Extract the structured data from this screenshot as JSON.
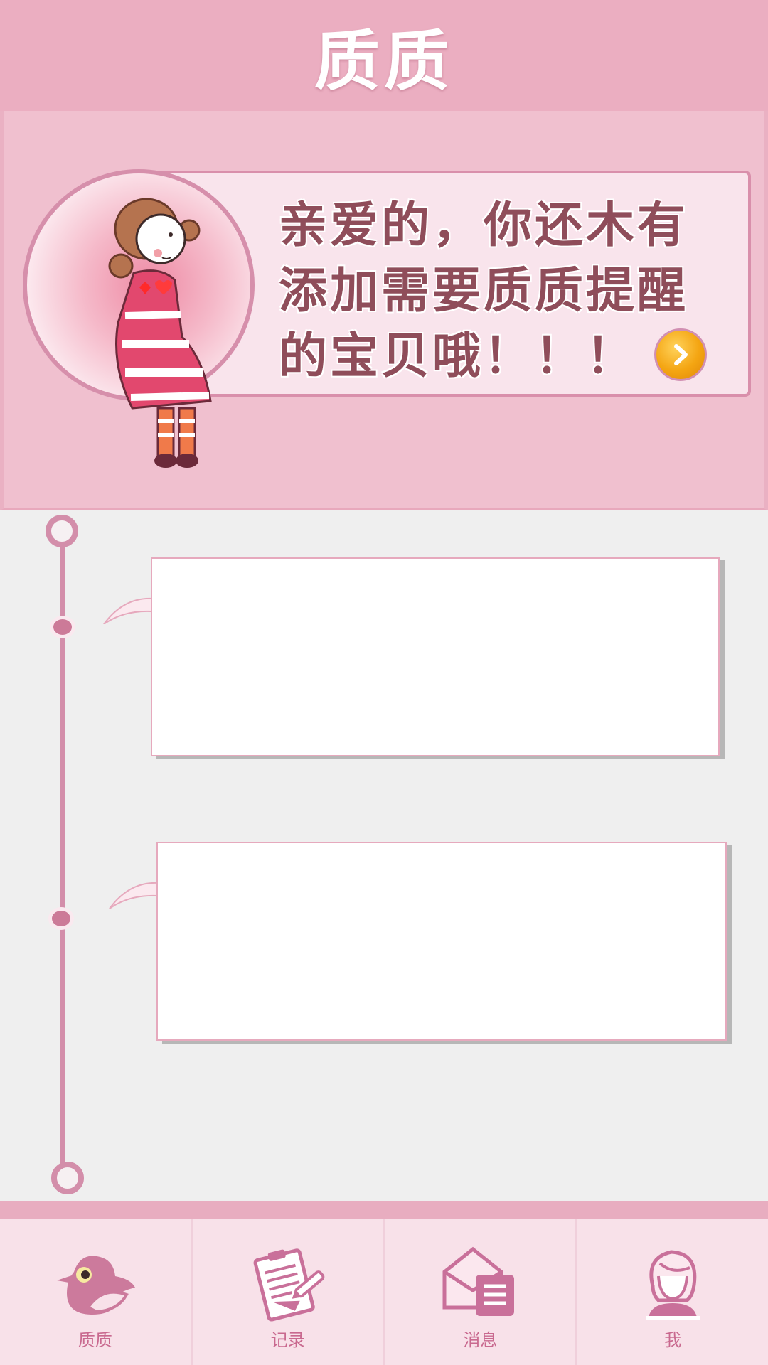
{
  "header": {
    "title": "质质"
  },
  "banner": {
    "message": "亲爱的，你还木有添加需要质质提醒的宝贝哦！！！",
    "go_icon": "chevron-right-icon"
  },
  "nav": {
    "items": [
      {
        "label": "质质",
        "icon": "bird-icon",
        "active": true
      },
      {
        "label": "记录",
        "icon": "clipboard-pen-icon",
        "active": false
      },
      {
        "label": "消息",
        "icon": "envelope-icon",
        "active": false
      },
      {
        "label": "我",
        "icon": "girl-avatar-icon",
        "active": false
      }
    ]
  },
  "colors": {
    "header": "#ebaec1",
    "accent": "#d38eaa",
    "text": "#8f4d5a",
    "nav_label": "#c9698f"
  }
}
